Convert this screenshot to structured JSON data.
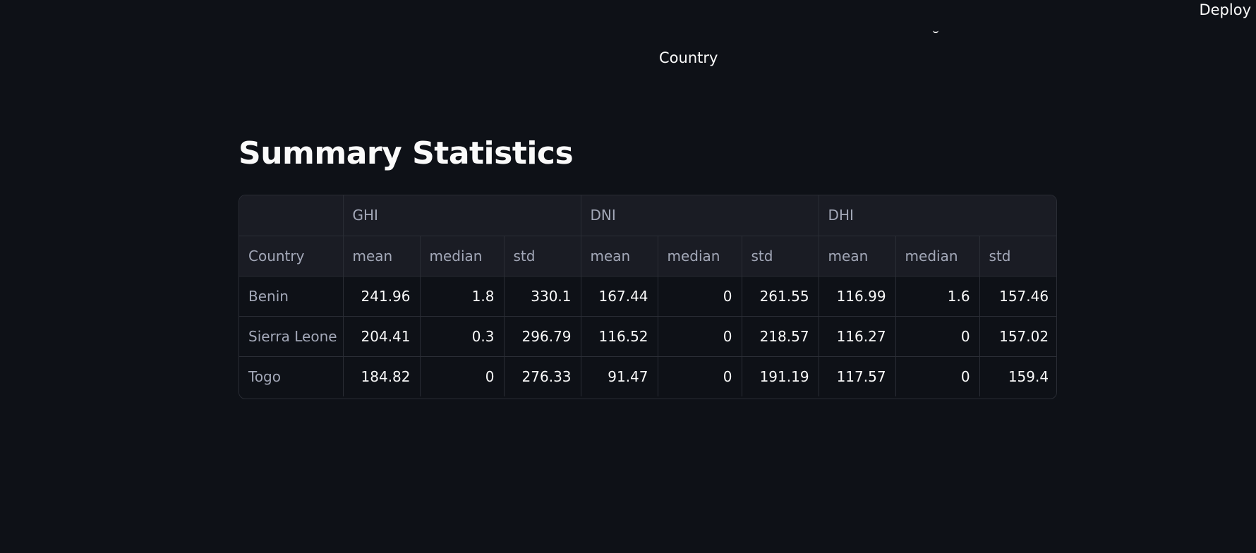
{
  "header": {
    "deploy_label": "Deploy"
  },
  "chart_fragment": {
    "xlabel": "Country"
  },
  "section": {
    "title": "Summary Statistics"
  },
  "table": {
    "groups": [
      "",
      "GHI",
      "DNI",
      "DHI"
    ],
    "columns": [
      "Country",
      "mean",
      "median",
      "std",
      "mean",
      "median",
      "std",
      "mean",
      "median",
      "std"
    ],
    "rows": [
      {
        "label": "Benin",
        "values": [
          "241.96",
          "1.8",
          "330.1",
          "167.44",
          "0",
          "261.55",
          "116.99",
          "1.6",
          "157.46"
        ]
      },
      {
        "label": "Sierra Leone",
        "values": [
          "204.41",
          "0.3",
          "296.79",
          "116.52",
          "0",
          "218.57",
          "116.27",
          "0",
          "157.02"
        ]
      },
      {
        "label": "Togo",
        "values": [
          "184.82",
          "0",
          "276.33",
          "91.47",
          "0",
          "191.19",
          "117.57",
          "0",
          "159.4"
        ]
      }
    ]
  }
}
